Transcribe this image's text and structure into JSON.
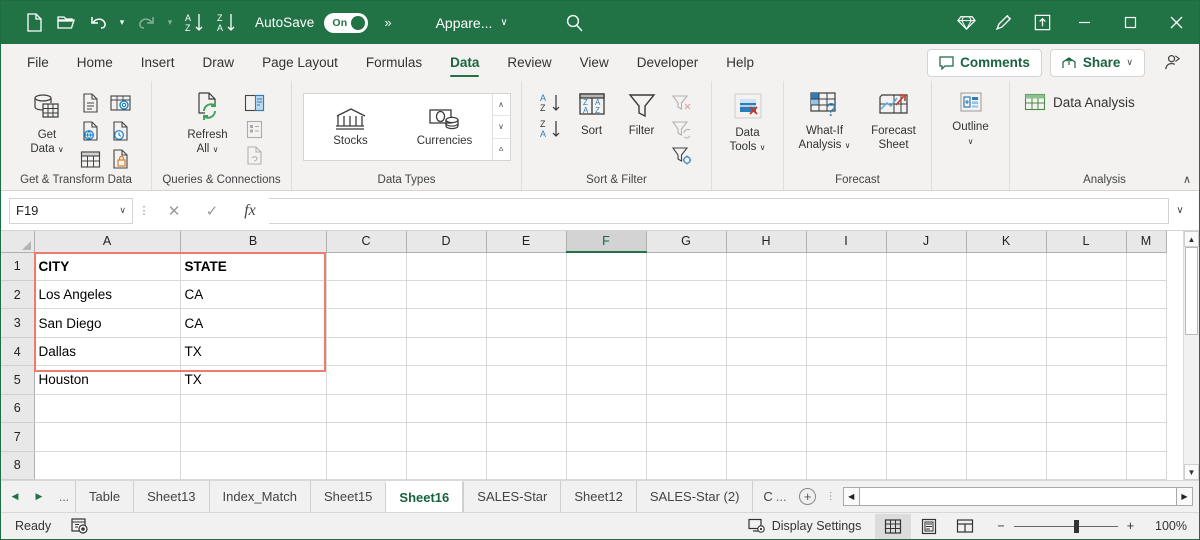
{
  "titlebar": {
    "quick_access": [
      {
        "name": "new-file-icon",
        "label": "New"
      },
      {
        "name": "open-folder-icon",
        "label": "Open"
      },
      {
        "name": "undo-icon",
        "label": "Undo"
      },
      {
        "name": "redo-icon",
        "label": "Redo"
      },
      {
        "name": "sort-ascending-icon",
        "label": "Sort A to Z"
      },
      {
        "name": "sort-descending-icon",
        "label": "Sort Z to A"
      }
    ],
    "autosave_label": "AutoSave",
    "autosave_state": "On",
    "more_commands": "»",
    "document_name": "Appare...",
    "document_chevron": "∨",
    "search_label": "Search",
    "right_icons": [
      {
        "name": "diamond-icon",
        "label": "Copilot"
      },
      {
        "name": "pen-icon",
        "label": "Draw"
      },
      {
        "name": "ribbon-display-options-icon",
        "label": "Ribbon Display Options"
      }
    ],
    "window_buttons": {
      "minimize": "─",
      "maximize": "□",
      "close": "✕"
    },
    "accent_color": "#217346"
  },
  "ribbon_tabs": {
    "tabs": [
      {
        "label": "File",
        "active": false
      },
      {
        "label": "Home",
        "active": false
      },
      {
        "label": "Insert",
        "active": false
      },
      {
        "label": "Draw",
        "active": false
      },
      {
        "label": "Page Layout",
        "active": false
      },
      {
        "label": "Formulas",
        "active": false
      },
      {
        "label": "Data",
        "active": true
      },
      {
        "label": "Review",
        "active": false
      },
      {
        "label": "View",
        "active": false
      },
      {
        "label": "Developer",
        "active": false
      },
      {
        "label": "Help",
        "active": false
      }
    ],
    "comments_label": "Comments",
    "share_label": "Share",
    "share_chevron": "∨",
    "share_person_icon": "share-person-icon"
  },
  "ribbon": {
    "groups": [
      {
        "label": "Get & Transform Data",
        "main_button": {
          "label_line1": "Get",
          "label_line2": "Data",
          "chevron": "∨",
          "icon": "get-data-icon"
        },
        "small_buttons": [
          {
            "name": "from-text-csv-icon"
          },
          {
            "name": "from-picture-icon"
          },
          {
            "name": "from-web-icon"
          },
          {
            "name": "recent-sources-icon"
          },
          {
            "name": "from-table-range-icon"
          },
          {
            "name": "existing-connections-icon"
          }
        ]
      },
      {
        "label": "Queries & Connections",
        "main_button": {
          "label_line1": "Refresh",
          "label_line2": "All",
          "chevron": "∨",
          "icon": "refresh-all-icon"
        },
        "small_buttons": [
          {
            "name": "queries-connections-pane-icon"
          },
          {
            "name": "properties-icon"
          },
          {
            "name": "edit-links-icon"
          }
        ]
      },
      {
        "label": "Data Types",
        "gallery": [
          {
            "label": "Stocks",
            "icon": "stocks-icon"
          },
          {
            "label": "Currencies",
            "icon": "currencies-icon"
          }
        ],
        "scroll": {
          "up": "∧",
          "down": "∨",
          "more": "⩟"
        }
      },
      {
        "label": "Sort & Filter",
        "items": [
          {
            "label": "",
            "name": "sort-az-icon"
          },
          {
            "label": "",
            "name": "sort-za-icon"
          },
          {
            "label": "Sort",
            "name": "sort-button"
          },
          {
            "label": "Filter",
            "name": "filter-button"
          },
          {
            "label": "",
            "name": "clear-filter-icon"
          },
          {
            "label": "",
            "name": "reapply-filter-icon"
          },
          {
            "label": "",
            "name": "advanced-filter-icon"
          }
        ]
      },
      {
        "label": "",
        "main_button": {
          "label_line1": "Data",
          "label_line2": "Tools",
          "chevron": "∨",
          "icon": "data-tools-icon"
        }
      },
      {
        "label": "Forecast",
        "buttons": [
          {
            "label_line1": "What-If",
            "label_line2": "Analysis",
            "chevron": "∨",
            "icon": "what-if-analysis-icon"
          },
          {
            "label_line1": "Forecast",
            "label_line2": "Sheet",
            "chevron": "",
            "icon": "forecast-sheet-icon"
          }
        ]
      },
      {
        "label": "",
        "main_button": {
          "label_line1": "Outline",
          "label_line2": "",
          "chevron": "∨",
          "icon": "outline-icon"
        }
      },
      {
        "label": "Analysis",
        "items": [
          {
            "label": "Data Analysis",
            "name": "data-analysis-button"
          }
        ]
      }
    ],
    "collapse": "∧"
  },
  "formula_bar": {
    "name_box_value": "F19",
    "name_box_chevron": "∨",
    "cancel_icon": "✕",
    "enter_icon": "✓",
    "function_icon": "fx",
    "formula_value": "",
    "expand_chevron": "∨"
  },
  "grid": {
    "columns": [
      "A",
      "B",
      "C",
      "D",
      "E",
      "F",
      "G",
      "H",
      "I",
      "J",
      "K",
      "L",
      "M"
    ],
    "selected_column": "F",
    "rows": [
      "1",
      "2",
      "3",
      "4",
      "5",
      "6",
      "7",
      "8"
    ],
    "data": [
      [
        "CITY",
        "STATE"
      ],
      [
        "Los Angeles",
        "CA"
      ],
      [
        "San Diego",
        "CA"
      ],
      [
        "Dallas",
        "TX"
      ],
      [
        "Houston",
        "TX"
      ]
    ],
    "bold_first_row": true,
    "highlight_color": "#ed7d6a",
    "highlight_range": "A1:B5",
    "scroll_up_arrow": "▲",
    "scroll_down_arrow": "▼"
  },
  "sheet_tabs": {
    "nav_first": "◀",
    "nav_last": "▶",
    "nav_dots": "...",
    "tabs": [
      {
        "label": "Table",
        "active": false
      },
      {
        "label": "Sheet13",
        "active": false
      },
      {
        "label": "Index_Match",
        "active": false
      },
      {
        "label": "Sheet15",
        "active": false
      },
      {
        "label": "Sheet16",
        "active": true
      },
      {
        "label": "SALES-Star",
        "active": false
      },
      {
        "label": "Sheet12",
        "active": false
      },
      {
        "label": "SALES-Star (2)",
        "active": false
      },
      {
        "label": "C",
        "active": false,
        "truncated": true
      }
    ],
    "overflow_dots": "...",
    "add_sheet": "+",
    "tab_menu_dots": "⋮",
    "hscroll_left": "◀",
    "hscroll_right": "▶"
  },
  "status_bar": {
    "status_text": "Ready",
    "recording_icon": "macro-record-icon",
    "display_settings_label": "Display Settings",
    "views": [
      {
        "name": "normal-view-button",
        "active": true
      },
      {
        "name": "page-layout-view-button",
        "active": false
      },
      {
        "name": "page-break-preview-button",
        "active": false
      }
    ],
    "zoom_out": "−",
    "zoom_in": "+",
    "zoom_value": "100%"
  }
}
